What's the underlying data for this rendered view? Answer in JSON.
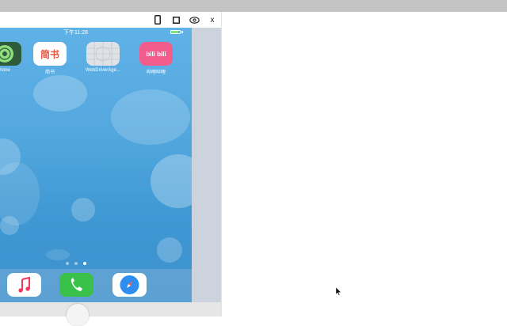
{
  "toolbar": {
    "icons": [
      "phone-icon",
      "square-icon",
      "eye-icon",
      "close-icon"
    ],
    "close_label": "x"
  },
  "status_bar": {
    "time": "下午11:28",
    "battery_fraction": 0.85,
    "battery_color": "#7ee37a"
  },
  "apps": [
    {
      "label": "hone",
      "icon": "find-iphone-icon",
      "color": "#2f5b3a"
    },
    {
      "label": "简书",
      "icon_text": "简书",
      "icon": "jianshu-icon",
      "color": "#ffffff",
      "text_color": "#e8553f"
    },
    {
      "label": "WebDriverAge...",
      "icon": "webdriveragent-icon",
      "color": "#dfe3e8"
    },
    {
      "label": "哔哩哔哩",
      "icon_text": "bili bili",
      "icon": "bilibili-icon",
      "color": "#f25d8e"
    }
  ],
  "page_dots": {
    "count": 3,
    "active_index": 2
  },
  "dock": [
    {
      "icon": "music-icon",
      "color": "#ffffff"
    },
    {
      "icon": "phone-call-icon",
      "color": "#39c14a"
    },
    {
      "icon": "safari-icon",
      "color": "#ffffff"
    }
  ]
}
